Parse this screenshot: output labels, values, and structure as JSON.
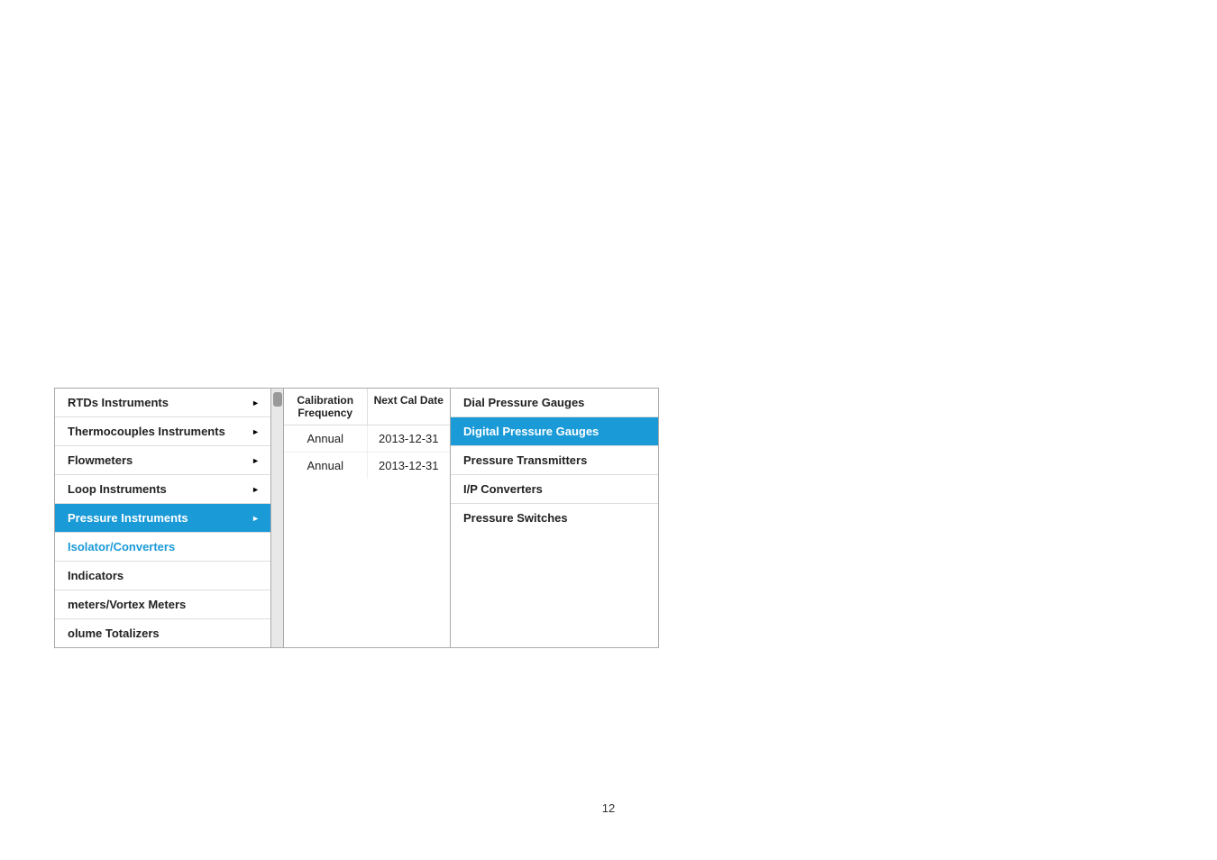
{
  "page": {
    "background": "#ffffff",
    "page_number": "12"
  },
  "menu": {
    "left_items": [
      {
        "id": "rtds",
        "label": "RTDs Instruments",
        "has_arrow": true,
        "style": "plain"
      },
      {
        "id": "thermocouples",
        "label": "Thermocouples Instruments",
        "has_arrow": true,
        "style": "plain"
      },
      {
        "id": "flowmeters",
        "label": "Flowmeters",
        "has_arrow": true,
        "style": "plain"
      },
      {
        "id": "loop",
        "label": "Loop Instruments",
        "has_arrow": true,
        "style": "plain"
      },
      {
        "id": "pressure",
        "label": "Pressure Instruments",
        "has_arrow": true,
        "style": "highlighted"
      },
      {
        "id": "isolator",
        "label": "Isolator/Converters",
        "has_arrow": false,
        "style": "partial-blue"
      },
      {
        "id": "indicators",
        "label": "Indicators",
        "has_arrow": false,
        "style": "plain"
      },
      {
        "id": "meters",
        "label": "meters/Vortex Meters",
        "has_arrow": false,
        "style": "plain"
      },
      {
        "id": "volume",
        "label": "olume Totalizers",
        "has_arrow": false,
        "style": "plain"
      }
    ],
    "cal_header": {
      "col1": "Calibration Frequency",
      "col2": "Next Cal Date"
    },
    "cal_rows": [
      {
        "col1": "Annual",
        "col2": "2013-12-31"
      },
      {
        "col1": "Annual",
        "col2": "2013-12-31"
      }
    ],
    "right_items": [
      {
        "id": "dial",
        "label": "Dial Pressure Gauges",
        "style": "plain"
      },
      {
        "id": "digital",
        "label": "Digital Pressure Gauges",
        "style": "highlighted"
      },
      {
        "id": "transmitters",
        "label": "Pressure Transmitters",
        "style": "plain"
      },
      {
        "id": "ip",
        "label": "I/P Converters",
        "style": "plain"
      },
      {
        "id": "switches",
        "label": "Pressure Switches",
        "style": "plain"
      }
    ]
  }
}
